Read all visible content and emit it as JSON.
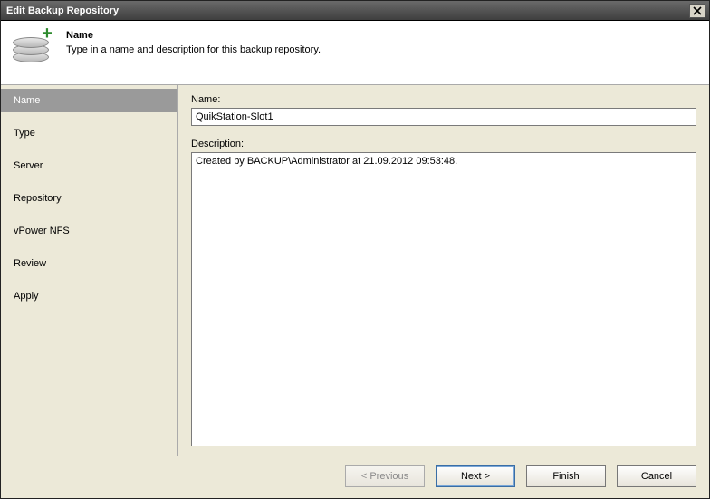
{
  "window": {
    "title": "Edit Backup Repository"
  },
  "header": {
    "title": "Name",
    "subtitle": "Type in a name and description for this backup repository."
  },
  "sidebar": {
    "items": [
      {
        "label": "Name",
        "active": true
      },
      {
        "label": "Type",
        "active": false
      },
      {
        "label": "Server",
        "active": false
      },
      {
        "label": "Repository",
        "active": false
      },
      {
        "label": "vPower NFS",
        "active": false
      },
      {
        "label": "Review",
        "active": false
      },
      {
        "label": "Apply",
        "active": false
      }
    ]
  },
  "form": {
    "name_label": "Name:",
    "name_value": "QuikStation-Slot1",
    "description_label": "Description:",
    "description_value": "Created by BACKUP\\Administrator at 21.09.2012 09:53:48."
  },
  "footer": {
    "previous": "< Previous",
    "next": "Next >",
    "finish": "Finish",
    "cancel": "Cancel"
  }
}
